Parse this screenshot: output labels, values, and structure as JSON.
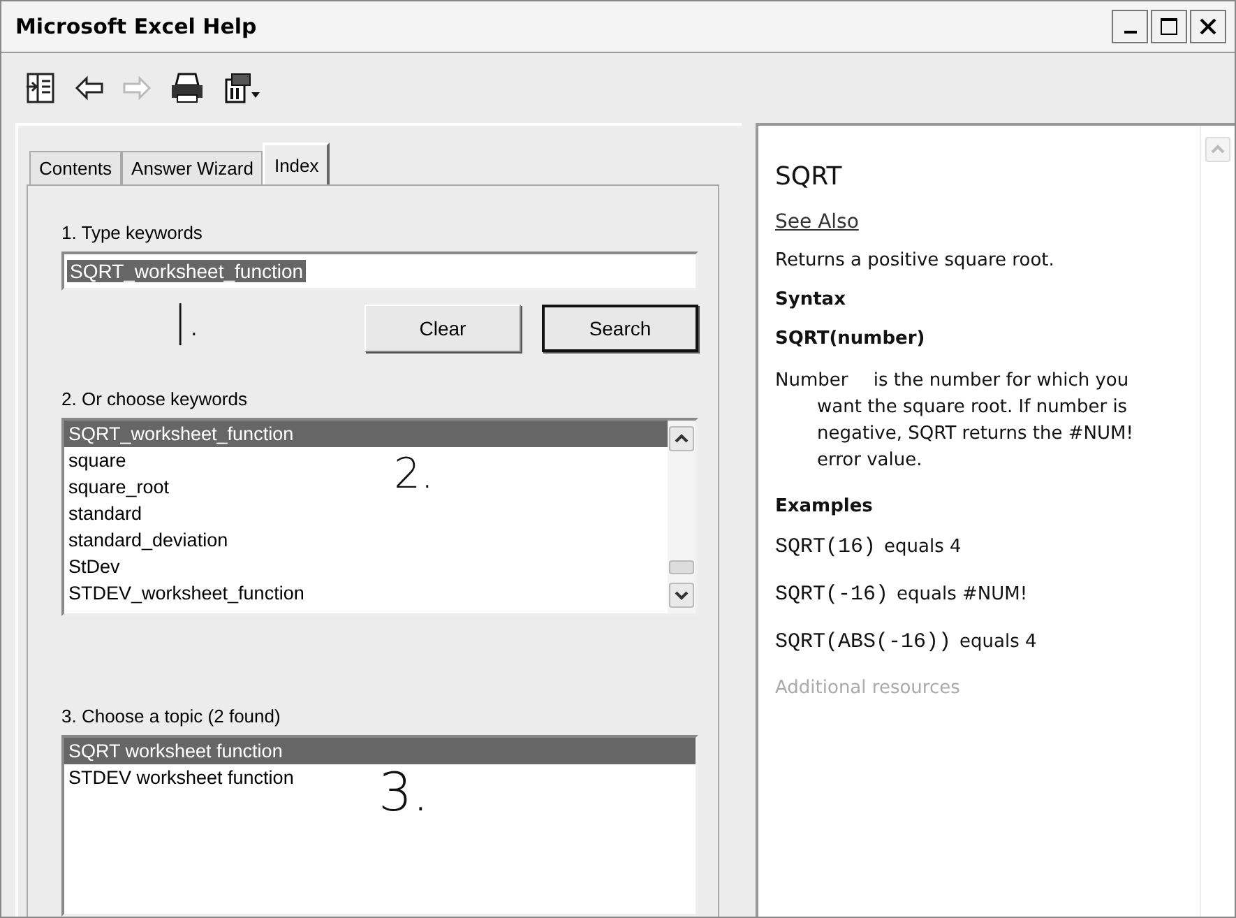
{
  "window": {
    "title": "Microsoft Excel Help"
  },
  "toolbar": [
    {
      "kind": "show"
    },
    {
      "kind": "back",
      "disabled": false
    },
    {
      "kind": "forward",
      "disabled": true
    },
    {
      "kind": "print"
    },
    {
      "kind": "options"
    }
  ],
  "tabs": [
    {
      "label": "Contents",
      "selected": false
    },
    {
      "label": "Answer Wizard",
      "selected": false
    },
    {
      "label": "Index",
      "selected": true
    }
  ],
  "step1": {
    "label": "1. Type keywords",
    "value": "SQRT_worksheet_function",
    "buttons": [
      {
        "label": "Clear",
        "default": false
      },
      {
        "label": "Search",
        "default": true
      }
    ],
    "annotation": "|."
  },
  "step2": {
    "label": "2. Or choose keywords",
    "annotation": "2.",
    "items": [
      {
        "text": "SQRT_worksheet_function",
        "selected": true
      },
      {
        "text": "square",
        "selected": false
      },
      {
        "text": "square_root",
        "selected": false
      },
      {
        "text": "standard",
        "selected": false
      },
      {
        "text": "standard_deviation",
        "selected": false
      },
      {
        "text": "StDev",
        "selected": false
      },
      {
        "text": "STDEV_worksheet_function",
        "selected": false
      }
    ]
  },
  "step3": {
    "label": "3. Choose a topic (2 found)",
    "annotation": "3.",
    "items": [
      {
        "text": "SQRT worksheet function",
        "selected": true
      },
      {
        "text": "STDEV worksheet function",
        "selected": false
      }
    ]
  },
  "topic": {
    "title": "SQRT",
    "see_also": "See Also",
    "summary": "Returns a positive square root.",
    "syntax_heading": "Syntax",
    "syntax": "SQRT(number)",
    "argument": "Number",
    "argument_text": "is the number for which you want the square root. If number is negative, SQRT returns the #NUM! error value.",
    "examples_heading": "Examples",
    "examples": [
      {
        "code": "SQRT(16)",
        "result": "equals 4"
      },
      {
        "code": "SQRT(-16)",
        "result": "equals #NUM!"
      },
      {
        "code": "SQRT(ABS(-16))",
        "result": "equals 4"
      }
    ],
    "more": "Additional resources"
  }
}
